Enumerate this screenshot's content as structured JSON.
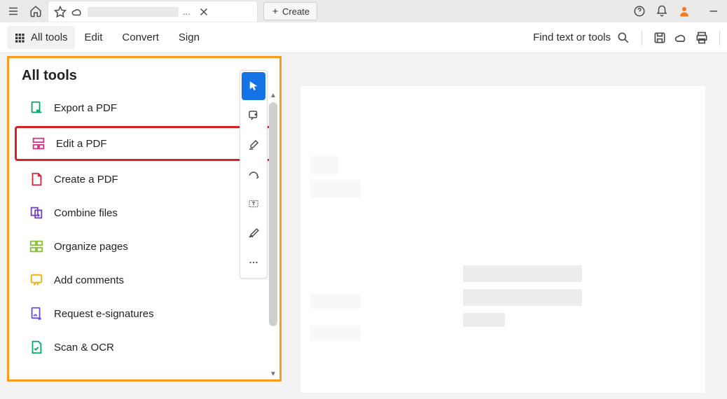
{
  "tabbar": {
    "tab_suffix": "...",
    "create_label": "Create"
  },
  "toolbar": {
    "all_tools": "All tools",
    "edit": "Edit",
    "convert": "Convert",
    "sign": "Sign",
    "find": "Find text or tools"
  },
  "panel": {
    "title": "All tools",
    "tools": [
      {
        "label": "Export a PDF",
        "icon": "export-pdf-icon",
        "color": "#0aa56a"
      },
      {
        "label": "Edit a PDF",
        "icon": "edit-pdf-icon",
        "color": "#d63384",
        "highlight": true
      },
      {
        "label": "Create a PDF",
        "icon": "create-pdf-icon",
        "color": "#d7263d"
      },
      {
        "label": "Combine files",
        "icon": "combine-icon",
        "color": "#6f42c1"
      },
      {
        "label": "Organize pages",
        "icon": "organize-icon",
        "color": "#86c232"
      },
      {
        "label": "Add comments",
        "icon": "comments-icon",
        "color": "#f0ad00"
      },
      {
        "label": "Request e-signatures",
        "icon": "esign-icon",
        "color": "#7048e8"
      },
      {
        "label": "Scan & OCR",
        "icon": "scan-ocr-icon",
        "color": "#0aa56a"
      }
    ]
  },
  "vtools": [
    {
      "name": "select-tool",
      "active": true
    },
    {
      "name": "add-note-tool",
      "active": false
    },
    {
      "name": "highlight-tool",
      "active": false
    },
    {
      "name": "draw-tool",
      "active": false
    },
    {
      "name": "text-box-tool",
      "active": false
    },
    {
      "name": "sign-tool",
      "active": false
    },
    {
      "name": "more-tools",
      "active": false
    }
  ]
}
